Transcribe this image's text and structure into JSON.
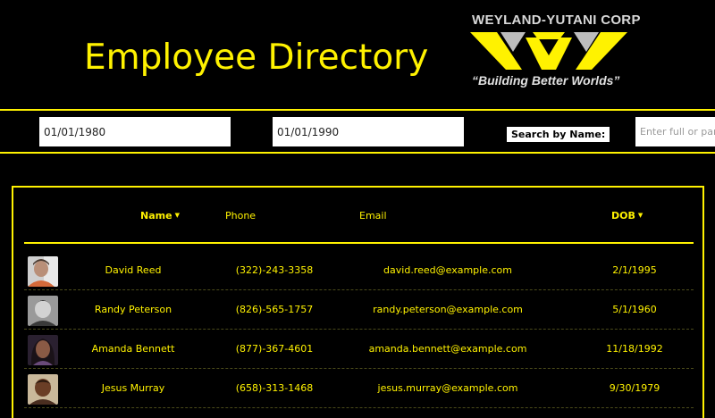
{
  "header": {
    "title": "Employee Directory",
    "logo": {
      "company": "WEYLAND-YUTANI CORP",
      "tagline": "“Building Better Worlds”"
    }
  },
  "filters": {
    "date_from": "01/01/1980",
    "date_to": "01/01/1990",
    "search_label": "Search by Name:",
    "name_placeholder": "Enter full or partial name"
  },
  "table": {
    "columns": {
      "name": "Name",
      "phone": "Phone",
      "email": "Email",
      "dob": "DOB"
    },
    "rows": [
      {
        "name": "David Reed",
        "phone": "(322)-243-3358",
        "email": "david.reed@example.com",
        "dob": "2/1/1995",
        "avatar": "avatar-photo"
      },
      {
        "name": "Randy Peterson",
        "phone": "(826)-565-1757",
        "email": "randy.peterson@example.com",
        "dob": "5/1/1960",
        "avatar": "avatar-photo"
      },
      {
        "name": "Amanda Bennett",
        "phone": "(877)-367-4601",
        "email": "amanda.bennett@example.com",
        "dob": "11/18/1992",
        "avatar": "avatar-photo"
      },
      {
        "name": "Jesus Murray",
        "phone": "(658)-313-1468",
        "email": "jesus.murray@example.com",
        "dob": "9/30/1979",
        "avatar": "avatar-photo"
      }
    ]
  },
  "colors": {
    "accent": "#fff200",
    "background": "#000000"
  }
}
